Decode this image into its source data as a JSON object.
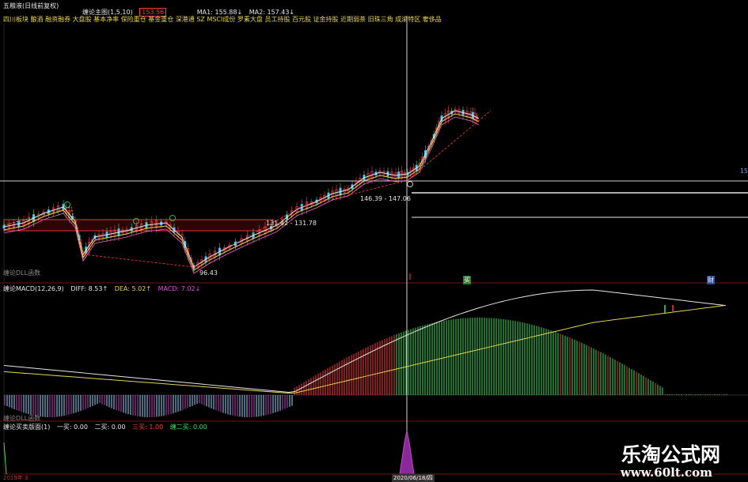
{
  "top_strip": {
    "stock_name": "五粮液(日线前复权)",
    "indicator": "缠论主图(1,5,10)",
    "price_box": "153.56",
    "ma1": "MA1: 155.88↓",
    "ma2": "MA2: 157.43↓"
  },
  "sector_line": "四川板块 酿酒 融资融券 大盘股 基本净率 保险重仓 基金重仓 深港通 SZ MSCI成份 罗素大盘 员工持股 百元股 证金持股 近期弱茶 旧珠三角 成渝特区 奢侈品",
  "main_chart": {
    "annotations": [
      {
        "id": "a1",
        "text": "146.39 - 147.06"
      },
      {
        "id": "a2",
        "text": "131.42 - 131.78"
      },
      {
        "id": "a3",
        "text": "96.43"
      }
    ],
    "marker_circles": [
      "1",
      "2",
      "3",
      "4"
    ],
    "bottom_left_label": "缠论DLL函数",
    "signal_buy": "买",
    "signal_sell": "财",
    "right_tick": "15"
  },
  "macd_panel": {
    "title": "缠论MACD(12,26,9)",
    "diff": "DIFF: 8.53↑",
    "dea": "DEA: 5.02↑",
    "macd": "MACD: 7.02↓",
    "bottom_left_label": "缠论DLL函数"
  },
  "buy_panel": {
    "title": "缠论买卖版面(1)",
    "yi_mai": "一买: 0.00",
    "er_mai": "二买: 0.00",
    "san_mai": "三买: 1.00",
    "lei_er_mai": "缠二买: 0.00",
    "bottom_date": "2020/06/18/四",
    "bottom_left": "2019年 3"
  },
  "watermark": {
    "title": "乐淘公式网",
    "url": "www.60lt.com"
  },
  "colors": {
    "up": "#ff3b3b",
    "down": "#3ee05a",
    "diff_line": "#e6e6e6",
    "dea_line": "#e8d44d",
    "macd_neg": "#9ad8ff",
    "macd_magenta": "#c04ac0",
    "separator": "#7a1010"
  }
}
